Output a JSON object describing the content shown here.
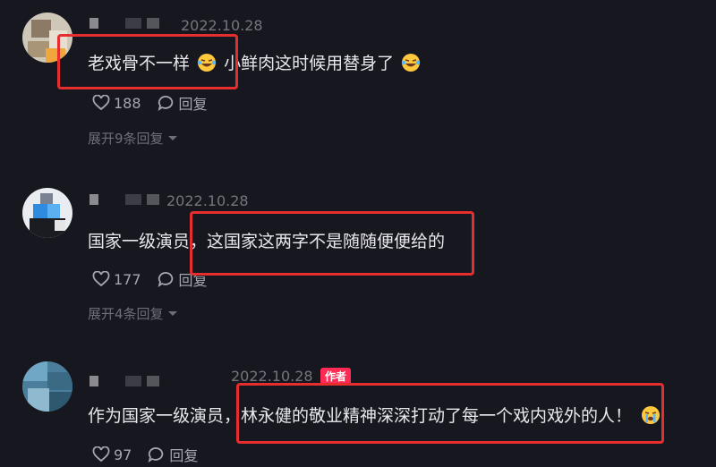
{
  "comments": [
    {
      "date": "2022.10.28",
      "text_a": "老戏骨不一样",
      "text_b": "小鲜肉这时候用替身了",
      "likes": "188",
      "reply_label": "回复",
      "expand_label": "展开9条回复"
    },
    {
      "date": "2022.10.28",
      "text": "国家一级演员，这国家这两字不是随随便便给的",
      "likes": "177",
      "reply_label": "回复",
      "expand_label": "展开4条回复"
    },
    {
      "date": "2022.10.28",
      "author_tag": "作者",
      "text": "作为国家一级演员，林永健的敬业精神深深打动了每一个戏内戏外的人！",
      "likes": "97",
      "reply_label": "回复"
    }
  ],
  "icons": {
    "like": "heart-icon",
    "reply": "speech-bubble-icon",
    "expand": "chevron-down-icon",
    "emoji_laugh": "tears-of-joy-emoji",
    "emoji_cry": "crying-emoji"
  },
  "colors": {
    "background": "#16171f",
    "highlight_box": "#e62e2e",
    "author_tag": "#fe2c55"
  }
}
